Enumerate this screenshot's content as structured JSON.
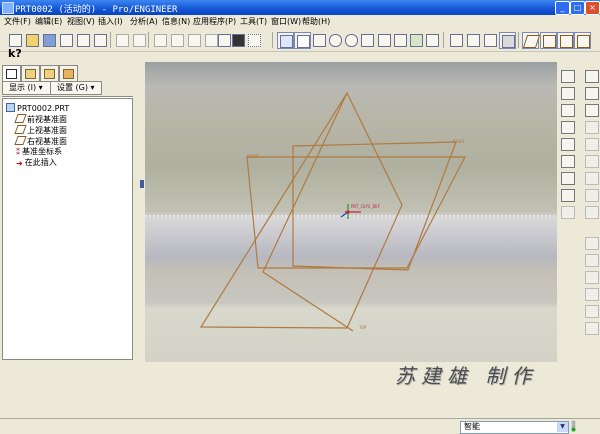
{
  "window": {
    "title": "PRT0002 (活动的) - Pro/ENGINEER",
    "buttons": {
      "minimize": "_",
      "maximize": "□",
      "close": "×"
    }
  },
  "menu": [
    "文件(F)",
    "编辑(E)",
    "视图(V)",
    "插入(I)",
    "分析(A)",
    "信息(N)",
    "应用程序(P)",
    "工具(T)",
    "窗口(W)",
    "帮助(H)"
  ],
  "toolbar": {
    "icons": [
      "new-icon",
      "open-icon",
      "save-icon",
      "print-icon",
      "email-icon",
      "send-icon",
      "undo-icon",
      "redo-icon",
      "cut-icon",
      "copy-icon",
      "paste-icon",
      "paste-special-icon",
      "regenerate-icon",
      "find-icon",
      "select-box-icon",
      "repaint-icon",
      "spin-center-icon",
      "orient-icon",
      "zoom-in-icon",
      "zoom-out-icon",
      "refit-icon",
      "reorient-icon",
      "saved-views-icon",
      "layers-icon",
      "view-manager-icon",
      "wireframe-icon",
      "hidden-line-icon",
      "no-hidden-icon",
      "shading-icon",
      "datum-planes-icon",
      "datum-axes-icon",
      "datum-points-icon",
      "csys-icon"
    ],
    "context_help_icon": "context-help-icon"
  },
  "left_panel": {
    "tabs": [
      "model-tree-tab",
      "layers-tab",
      "favorites-tab",
      "connections-tab"
    ],
    "show_button": "显示 (I) ▾",
    "settings_button": "设置 (G) ▾",
    "tree": [
      {
        "label": "PRT0002.PRT",
        "icon": "part-icon"
      },
      {
        "label": "前视基准面",
        "icon": "datum-plane-icon"
      },
      {
        "label": "上视基准面",
        "icon": "datum-plane-icon"
      },
      {
        "label": "右视基准面",
        "icon": "datum-plane-icon"
      },
      {
        "label": "基准坐标系",
        "icon": "coordinate-system-icon"
      },
      {
        "label": "在此插入",
        "icon": "insert-here-icon"
      }
    ]
  },
  "canvas": {
    "planes": [
      {
        "label": "FRONT"
      },
      {
        "label": "RIGHT"
      },
      {
        "label": "TOP"
      }
    ],
    "csys_label": "PRT_CSYS_DEF",
    "colors": {
      "datum": "#b07a40",
      "csys": "#c02040"
    }
  },
  "right_toolbar": {
    "icons": [
      "datum-plane-tool-icon",
      "datum-axis-tool-icon",
      "datum-curve-tool-icon",
      "datum-point-tool-icon",
      "csys-tool-icon",
      "analysis-icon",
      "sketch-icon",
      "extrude-icon",
      "revolve-icon",
      "variable-sweep-icon",
      "blend-icon",
      "hole-icon",
      "shell-icon",
      "rib-icon",
      "draft-icon",
      "round-icon",
      "chamfer-icon",
      "mirror-icon",
      "merge-icon",
      "trim-icon",
      "pattern-icon",
      "offset-icon",
      "thicken-icon",
      "solidify-icon"
    ]
  },
  "watermark": "苏建雄 制作",
  "status_bar": {
    "filter_value": "智能",
    "filter_arrow": "▼"
  }
}
